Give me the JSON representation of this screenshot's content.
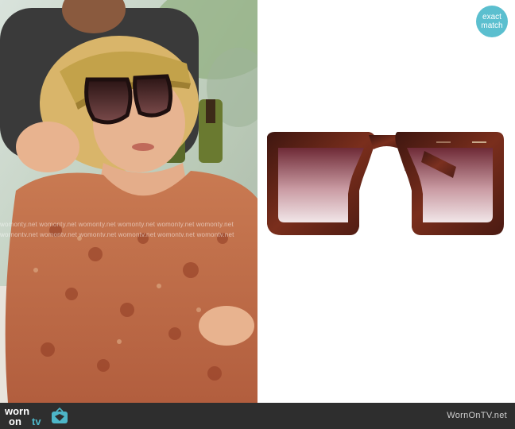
{
  "watermark": {
    "line1": "womonty.net  womonty.net  womonty.net  womonty.net  womonty.net  womonty.net",
    "line2": "wornontv.net  womontv.net  womontv.net  womontv.net  womontv.net  womontv.net"
  },
  "badge": {
    "line1": "exact",
    "line2": "match"
  },
  "footer": {
    "logo_worn": "worn",
    "logo_on": "on",
    "logo_tv": "tv",
    "site": "WornOnTV.net"
  },
  "colors": {
    "badge": "#5bbfcf",
    "footer": "#2e2e2e",
    "tortoise": "#5a1f15",
    "lens_top": "#6b2a34",
    "dress": "#c06a45"
  }
}
